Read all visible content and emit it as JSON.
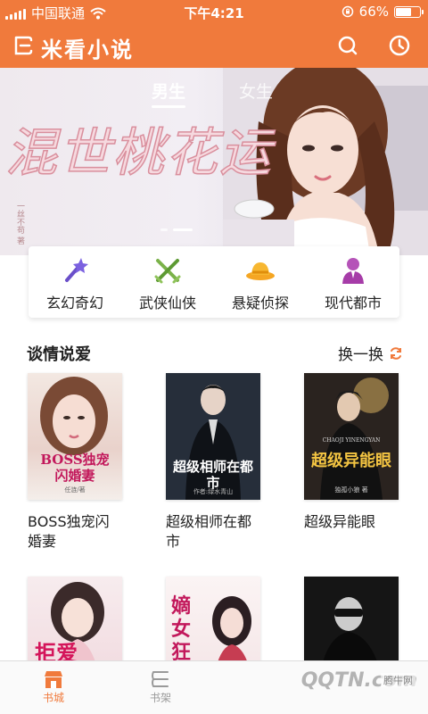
{
  "status_bar": {
    "carrier": "中国联通",
    "time": "下午4:21",
    "battery": "66%",
    "battery_level": 0.66
  },
  "header": {
    "title": "米看小说",
    "icons": [
      "search-icon",
      "history-icon"
    ]
  },
  "banner": {
    "tabs": [
      {
        "label": "男生",
        "active": true
      },
      {
        "label": "女生",
        "active": false
      }
    ],
    "book_title": "混世桃花运",
    "author": "一丝不苟 著",
    "slide_count": 2,
    "active_slide": 2
  },
  "categories": [
    {
      "label": "玄幻奇幻",
      "icon": "magic-wand-icon"
    },
    {
      "label": "武侠仙侠",
      "icon": "crossed-swords-icon"
    },
    {
      "label": "悬疑侦探",
      "icon": "detective-hat-icon"
    },
    {
      "label": "现代都市",
      "icon": "person-icon"
    }
  ],
  "section": {
    "title": "谈情说爱",
    "refresh_label": "换一换"
  },
  "books": [
    {
      "title": "BOSS独宠闪婚妻",
      "cover_text": "BOSS独宠闪婚妻",
      "cover_author": "任涟/著",
      "color": "#e8d7d3"
    },
    {
      "title": "超级相师在都市",
      "cover_text": "超级相师在都市",
      "cover_author": "作者:绿水青山",
      "color": "#1f2530"
    },
    {
      "title": "超级异能眼",
      "cover_text": "超级异能眼",
      "cover_sub": "CHAOJI YINENGYAN",
      "cover_author": "独孤小狼 著",
      "color": "#2b2420"
    },
    {
      "title": "",
      "cover_text": "拒爱",
      "cover_author": "",
      "color": "#f3e3e6"
    },
    {
      "title": "",
      "cover_text": "嫡女狂妃",
      "cover_author": "",
      "color": "#f6eef0"
    },
    {
      "title": "",
      "cover_text": "",
      "cover_author": "",
      "color": "#1a1a1a"
    }
  ],
  "tabbar": [
    {
      "label": "书城",
      "active": true
    },
    {
      "label": "书架",
      "active": false
    }
  ],
  "watermark": "QQTN.com",
  "watermark_sub": "腾牛网",
  "colors": {
    "accent": "#f07a3c"
  }
}
